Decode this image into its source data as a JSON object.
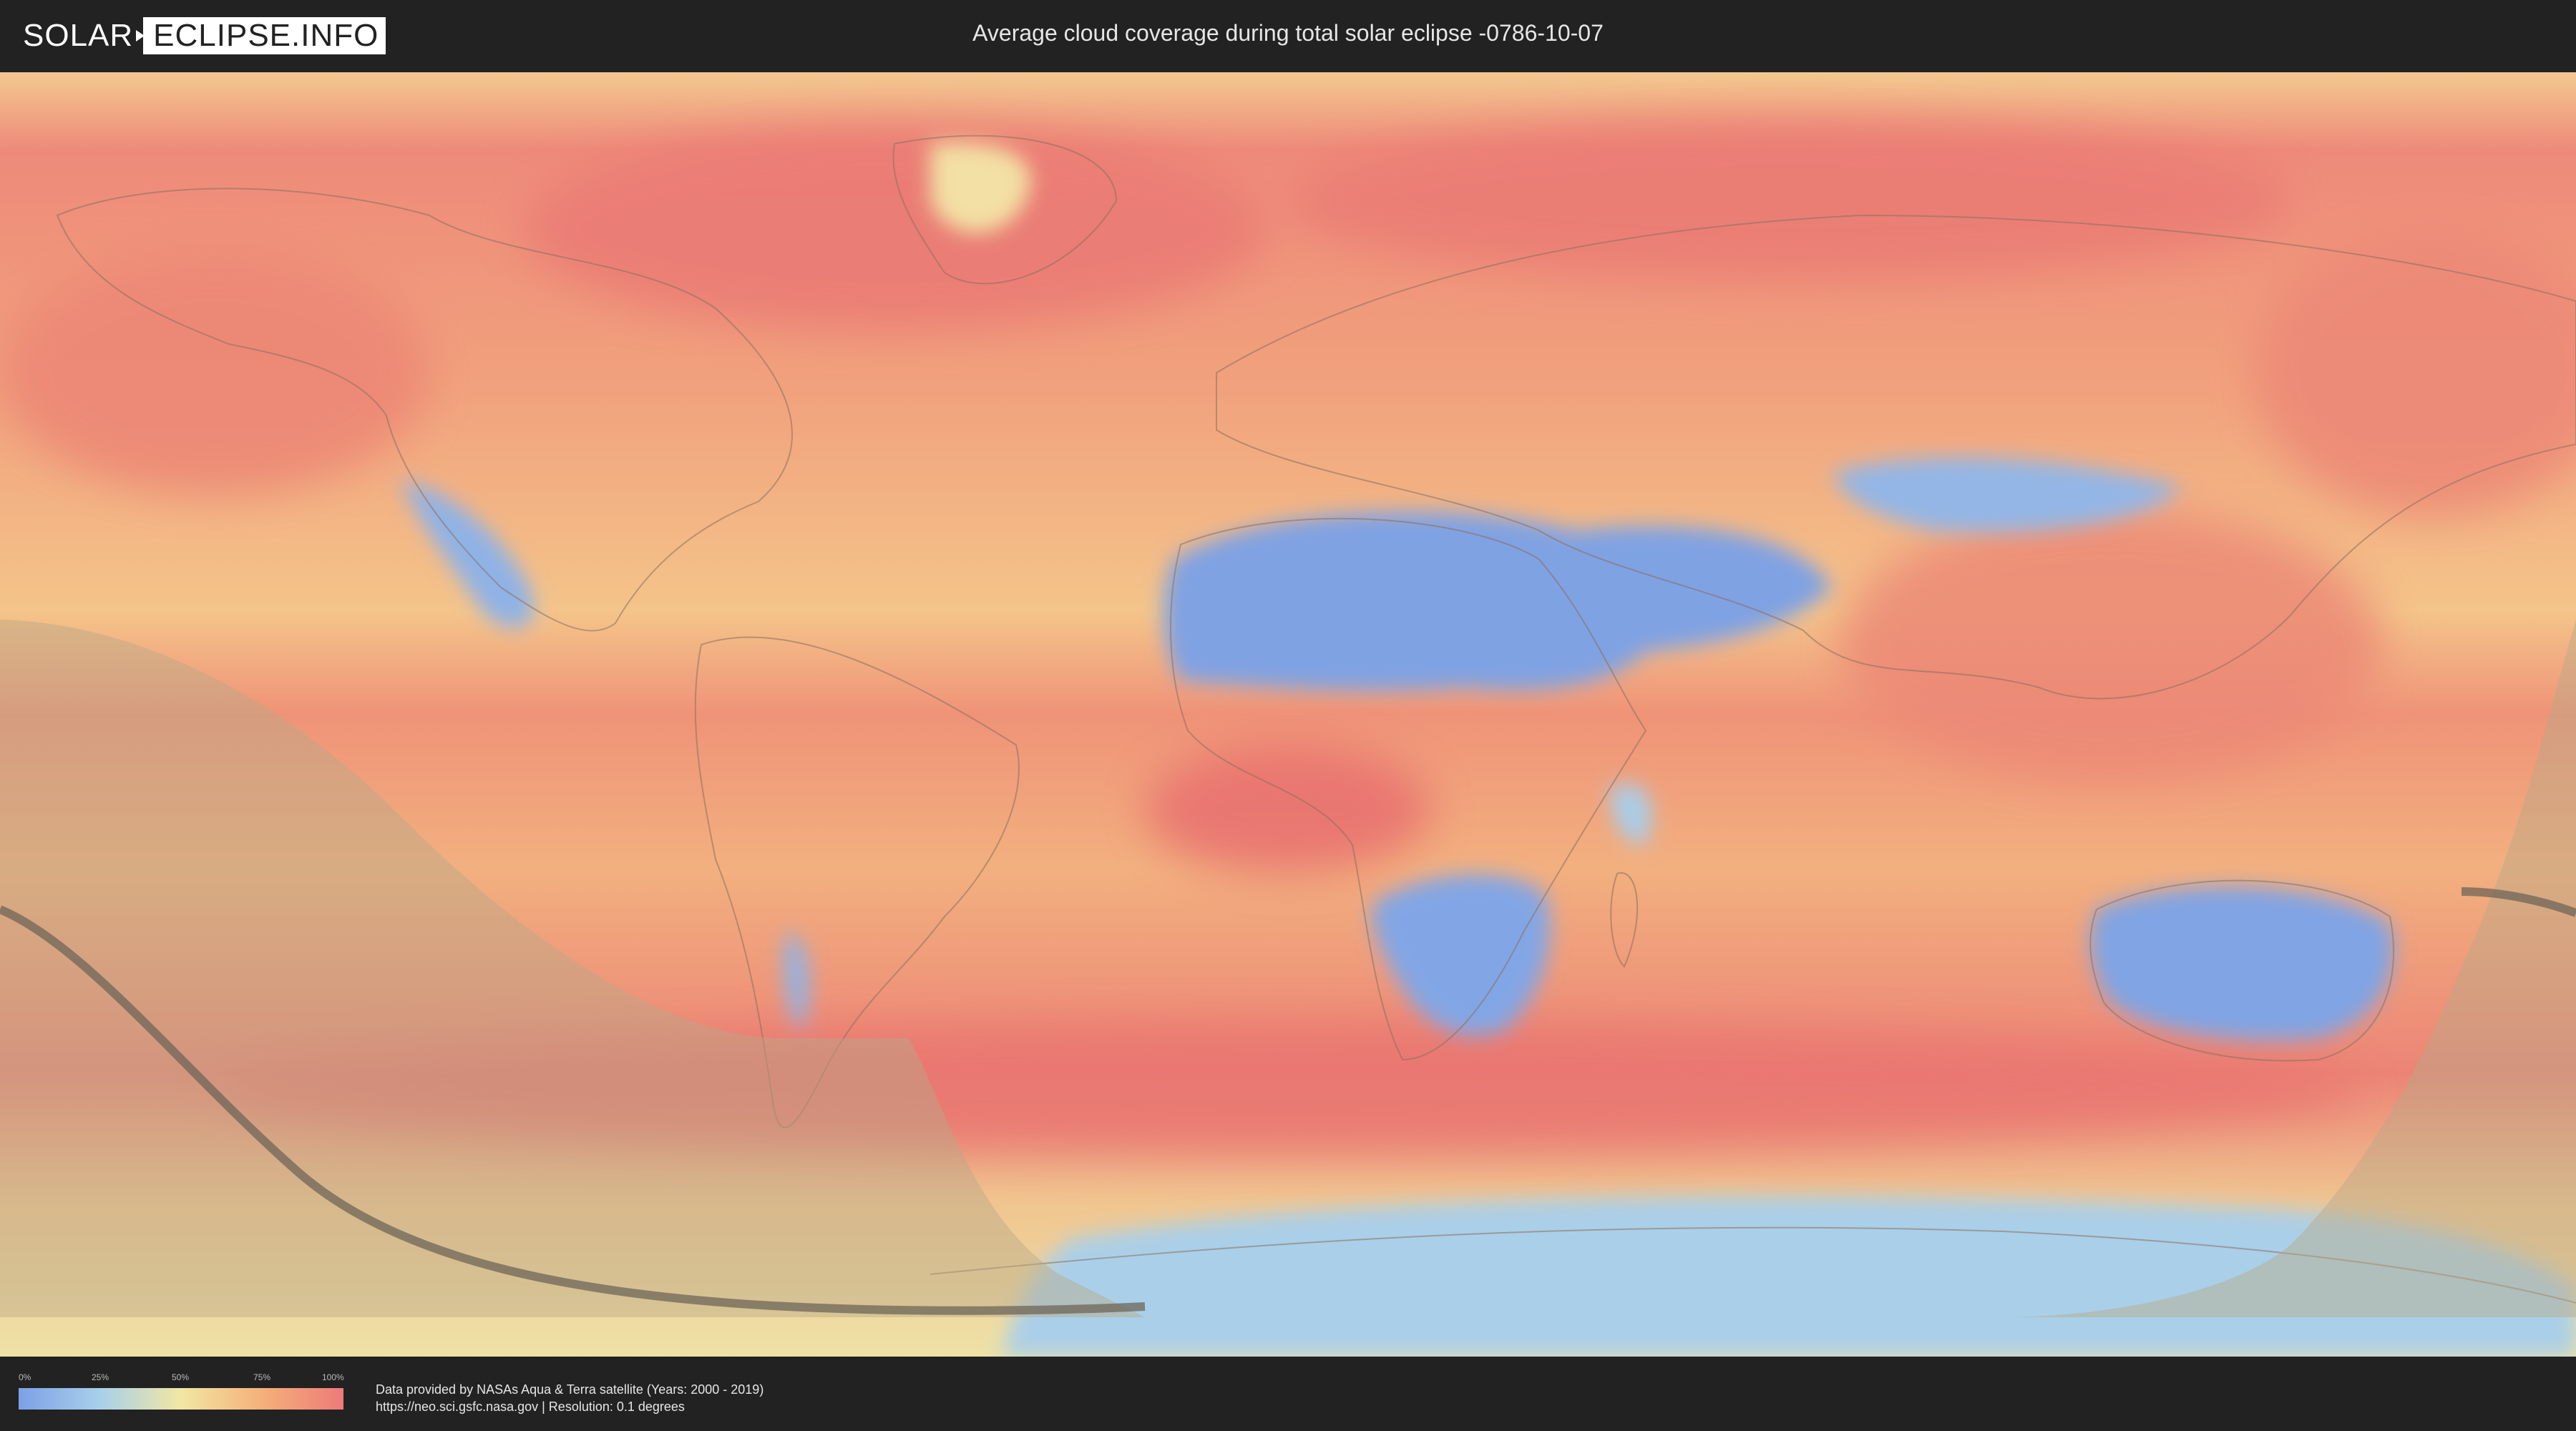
{
  "header": {
    "logo_part1": "SOLAR",
    "logo_part2": "ECLIPSE.INFO",
    "title": "Average cloud coverage during total solar eclipse -0786-10-07"
  },
  "legend": {
    "ticks": [
      "0%",
      "25%",
      "50%",
      "75%",
      "100%"
    ],
    "colors": [
      "#7da0e6",
      "#a8d0ea",
      "#f2e6a3",
      "#f4b07a",
      "#ee7a78"
    ]
  },
  "footer": {
    "credit_line1": "Data provided by NASAs Aqua & Terra satellite (Years: 2000 - 2019)",
    "credit_line2": "https://neo.sci.gsfc.nasa.gov | Resolution: 0.1 degrees"
  },
  "map": {
    "background_color": "#f2b47e",
    "eclipse_shadow_color": "#b8a888",
    "path_line_color": "#6e6658"
  }
}
